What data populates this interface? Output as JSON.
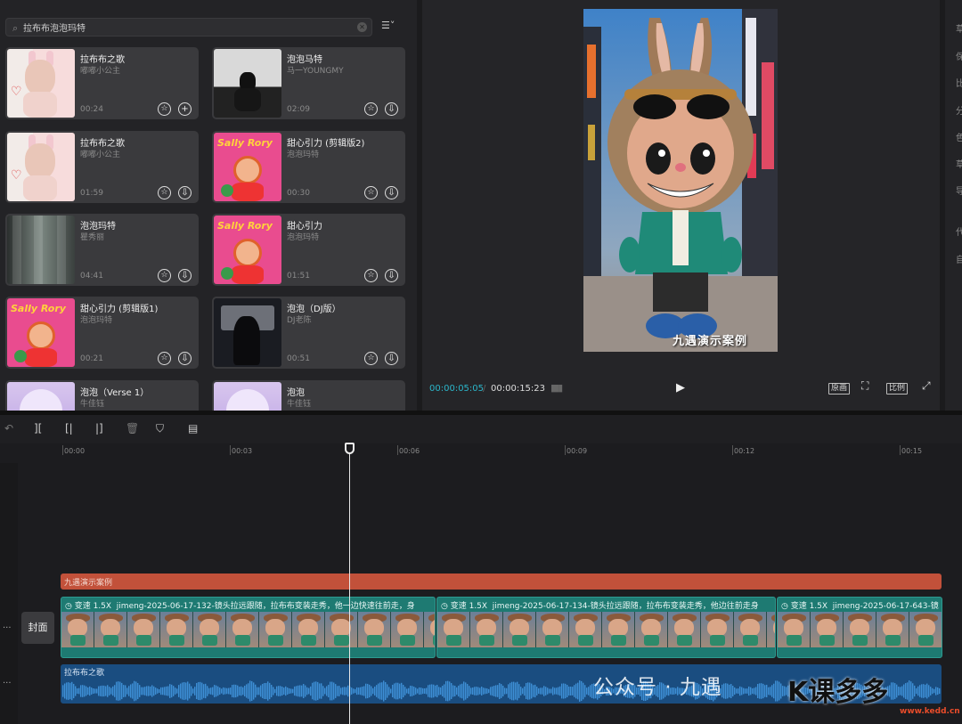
{
  "search": {
    "value": "拉布布泡泡玛特"
  },
  "media_items": [
    {
      "title": "拉布布之歌",
      "artist": "嘟嘟小公主",
      "duration": "00:24",
      "action": "+"
    },
    {
      "title": "泡泡马特",
      "artist": "马一YOUNGMY",
      "duration": "02:09",
      "action": "⇩"
    },
    {
      "title": "拉布布之歌",
      "artist": "嘟嘟小公主",
      "duration": "01:59",
      "action": "⇩"
    },
    {
      "title": "甜心引力 (剪辑版2)",
      "artist": "泡泡玛特",
      "duration": "00:30",
      "action": "⇩"
    },
    {
      "title": "泡泡玛特",
      "artist": "瞿秀丽",
      "duration": "04:41",
      "action": "⇩"
    },
    {
      "title": "甜心引力",
      "artist": "泡泡玛特",
      "duration": "01:51",
      "action": "⇩"
    },
    {
      "title": "甜心引力 (剪辑版1)",
      "artist": "泡泡玛特",
      "duration": "00:21",
      "action": "⇩"
    },
    {
      "title": "泡泡（DJ版）",
      "artist": "DJ老陈",
      "duration": "00:51",
      "action": "⇩"
    },
    {
      "title": "泡泡（Verse 1）",
      "artist": "牛佳钰",
      "duration": "",
      "action": ""
    },
    {
      "title": "泡泡",
      "artist": "牛佳钰",
      "duration": "",
      "action": ""
    }
  ],
  "preview": {
    "caption": "九遇演示案例",
    "current_time": "00:00:05:05",
    "separator": "/",
    "total_time": "00:00:15:23",
    "btn_original": "原画",
    "btn_ratio": "比例"
  },
  "right_panel": [
    "草",
    "保",
    "比",
    "分",
    "色",
    "草",
    "导",
    "代",
    "自"
  ],
  "timeline": {
    "ruler": [
      "00:00",
      "00:03",
      "00:06",
      "00:09",
      "00:12",
      "00:15"
    ],
    "text_clip": "九遇演示案例",
    "cover_label": "封面",
    "video_clips": [
      {
        "speed": "变速 1.5X",
        "name": "jimeng-2025-06-17-132-镜头拉远跟随，拉布布变装走秀，他一边快速往前走，身"
      },
      {
        "speed": "变速 1.5X",
        "name": "jimeng-2025-06-17-134-镜头拉远跟随，拉布布变装走秀，他边往前走身"
      },
      {
        "speed": "变速 1.5X",
        "name": "jimeng-2025-06-17-643-镜"
      }
    ],
    "audio_clip": "拉布布之歌"
  },
  "watermark": {
    "text": "公众号 · 九遇",
    "logo": "K课多多",
    "url": "www.kedd.cn"
  }
}
